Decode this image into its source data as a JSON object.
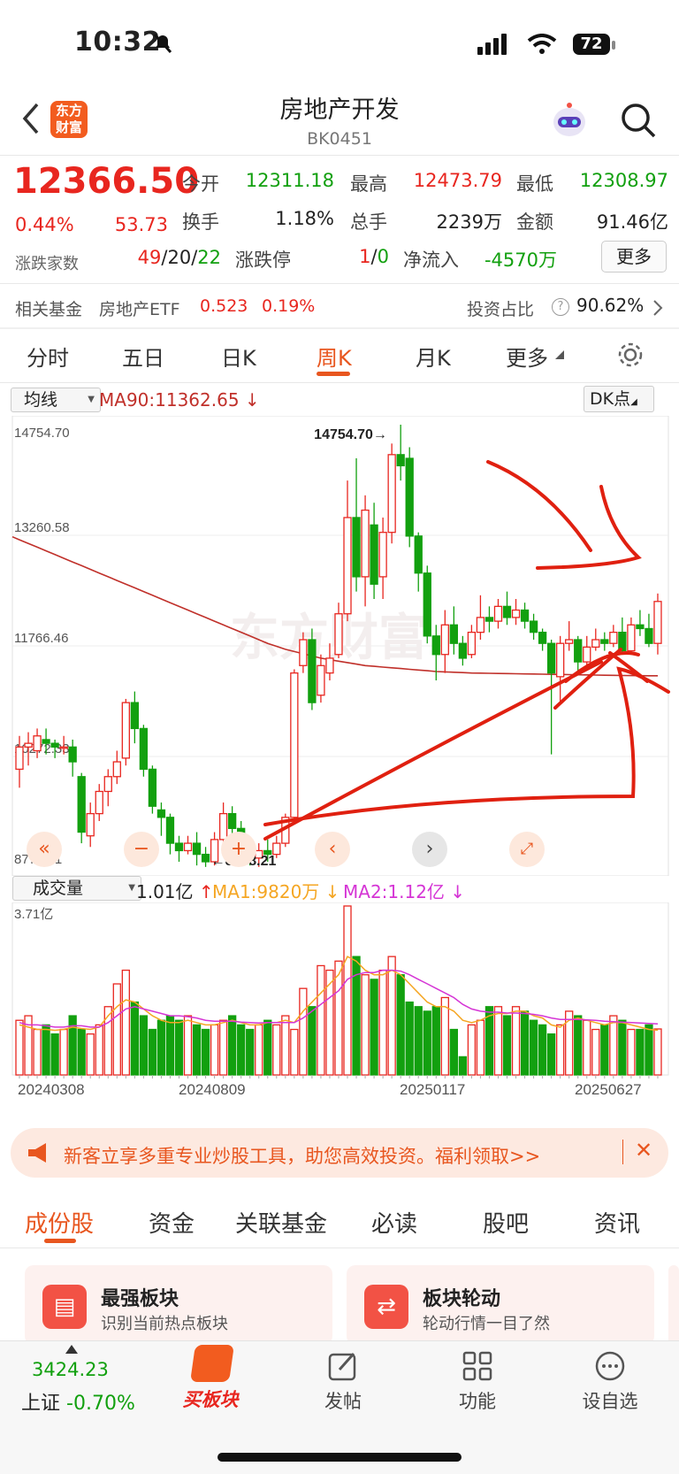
{
  "status_bar": {
    "time": "10:32",
    "battery": "72"
  },
  "header": {
    "logo_text": "东方财富",
    "title": "房地产开发",
    "code": "BK0451"
  },
  "quote": {
    "price": "12366.50",
    "change_pct": "0.44%",
    "change_abs": "53.73",
    "open_label": "今开",
    "open": "12311.18",
    "high_label": "最高",
    "high": "12473.79",
    "low_label": "最低",
    "low": "12308.97",
    "turnover_rate_label": "换手",
    "turnover_rate": "1.18%",
    "volume_label": "总手",
    "volume": "2239万",
    "amount_label": "金额",
    "amount": "91.46亿",
    "updown_label": "涨跌家数",
    "up_count": "49",
    "flat_count": "20",
    "down_count": "22",
    "limit_label": "涨跌停",
    "limit_up": "1",
    "limit_down": "0",
    "net_inflow_label": "净流入",
    "net_inflow": "-4570万",
    "more_label": "更多"
  },
  "fund_row": {
    "label": "相关基金",
    "fund_name": "房地产ETF",
    "fund_price": "0.523",
    "fund_change": "0.19%",
    "ratio_label": "投资占比",
    "ratio_value": "90.62%"
  },
  "period_tabs": [
    "分时",
    "五日",
    "日K",
    "周K",
    "月K",
    "更多"
  ],
  "active_period": "周K",
  "kline": {
    "indicator_select": "均线",
    "ma_label": "MA90:11362.65",
    "dk_label": "DK点",
    "axis_labels": [
      "14754.70",
      "13260.58",
      "11766.46",
      "10272.33",
      "8778.21"
    ],
    "max_label": "14754.70",
    "min_label": "8778.21",
    "watermark": "东方财富"
  },
  "volume_panel": {
    "select": "成交量",
    "current": "1.01亿",
    "ma1": "MA1:9820万",
    "ma2": "MA2:1.12亿",
    "max_label": "3.71亿",
    "dates": [
      "20240308",
      "20240809",
      "20250117",
      "20250627"
    ]
  },
  "colors": {
    "up": "#e8261f",
    "down": "#12a00f",
    "accent": "#e8561f",
    "ma90": "#c0302a",
    "ma1": "#f5a623",
    "ma2": "#d535d5"
  },
  "chart_data": {
    "type": "candlestick",
    "title": "",
    "ylim": [
      8778.21,
      14754.7
    ],
    "ma90": 11362.65,
    "candles": [
      {
        "o": 10100,
        "c": 10400,
        "h": 10550,
        "l": 9850
      },
      {
        "o": 10400,
        "c": 10450,
        "h": 10600,
        "l": 10150
      },
      {
        "o": 10350,
        "c": 10550,
        "h": 10650,
        "l": 10250
      },
      {
        "o": 10500,
        "c": 10450,
        "h": 10650,
        "l": 10300
      },
      {
        "o": 10450,
        "c": 10400,
        "h": 10500,
        "l": 10250
      },
      {
        "o": 10400,
        "c": 10400,
        "h": 10550,
        "l": 10300
      },
      {
        "o": 10400,
        "c": 10200,
        "h": 10500,
        "l": 10000
      },
      {
        "o": 10000,
        "c": 9250,
        "h": 10050,
        "l": 9100
      },
      {
        "o": 9200,
        "c": 9500,
        "h": 9650,
        "l": 9050
      },
      {
        "o": 9500,
        "c": 9800,
        "h": 9900,
        "l": 9400
      },
      {
        "o": 9800,
        "c": 10000,
        "h": 10100,
        "l": 9600
      },
      {
        "o": 10000,
        "c": 10200,
        "h": 10350,
        "l": 9900
      },
      {
        "o": 10250,
        "c": 11000,
        "h": 11050,
        "l": 10150
      },
      {
        "o": 11000,
        "c": 10650,
        "h": 11150,
        "l": 10450
      },
      {
        "o": 10650,
        "c": 10100,
        "h": 10700,
        "l": 10000
      },
      {
        "o": 10100,
        "c": 9600,
        "h": 10150,
        "l": 9500
      },
      {
        "o": 9550,
        "c": 9450,
        "h": 9650,
        "l": 9200
      },
      {
        "o": 9450,
        "c": 9100,
        "h": 9500,
        "l": 8950
      },
      {
        "o": 9100,
        "c": 9000,
        "h": 9200,
        "l": 8850
      },
      {
        "o": 9000,
        "c": 9100,
        "h": 9200,
        "l": 8950
      },
      {
        "o": 9100,
        "c": 8950,
        "h": 9250,
        "l": 8800
      },
      {
        "o": 8950,
        "c": 8850,
        "h": 9050,
        "l": 8780
      },
      {
        "o": 8850,
        "c": 9150,
        "h": 9250,
        "l": 8800
      },
      {
        "o": 9150,
        "c": 9500,
        "h": 9650,
        "l": 9100
      },
      {
        "o": 9500,
        "c": 9300,
        "h": 9600,
        "l": 9150
      },
      {
        "o": 9300,
        "c": 9100,
        "h": 9400,
        "l": 9000
      },
      {
        "o": 9100,
        "c": 8900,
        "h": 9150,
        "l": 8800
      },
      {
        "o": 8900,
        "c": 9000,
        "h": 9100,
        "l": 8780
      },
      {
        "o": 9000,
        "c": 8950,
        "h": 9150,
        "l": 8850
      },
      {
        "o": 8950,
        "c": 9100,
        "h": 9200,
        "l": 8900
      },
      {
        "o": 9100,
        "c": 9450,
        "h": 9500,
        "l": 9050
      },
      {
        "o": 9450,
        "c": 11400,
        "h": 11450,
        "l": 9400
      },
      {
        "o": 11500,
        "c": 11850,
        "h": 11950,
        "l": 11400
      },
      {
        "o": 11850,
        "c": 11000,
        "h": 12000,
        "l": 10900
      },
      {
        "o": 11100,
        "c": 11500,
        "h": 11650,
        "l": 11000
      },
      {
        "o": 11400,
        "c": 11600,
        "h": 11800,
        "l": 11300
      },
      {
        "o": 11650,
        "c": 12200,
        "h": 12350,
        "l": 11600
      },
      {
        "o": 12200,
        "c": 13500,
        "h": 14000,
        "l": 12100
      },
      {
        "o": 13500,
        "c": 12700,
        "h": 14300,
        "l": 12500
      },
      {
        "o": 12700,
        "c": 13600,
        "h": 13800,
        "l": 12300
      },
      {
        "o": 13400,
        "c": 12600,
        "h": 13700,
        "l": 12400
      },
      {
        "o": 12700,
        "c": 13300,
        "h": 13500,
        "l": 12400
      },
      {
        "o": 13300,
        "c": 14350,
        "h": 14500,
        "l": 13150
      },
      {
        "o": 14350,
        "c": 14200,
        "h": 14754.7,
        "l": 14000
      },
      {
        "o": 14300,
        "c": 13250,
        "h": 14450,
        "l": 13100
      },
      {
        "o": 13250,
        "c": 12750,
        "h": 13300,
        "l": 12500
      },
      {
        "o": 12750,
        "c": 11900,
        "h": 12850,
        "l": 11800
      },
      {
        "o": 11900,
        "c": 11650,
        "h": 12050,
        "l": 11300
      },
      {
        "o": 11650,
        "c": 12050,
        "h": 12250,
        "l": 11400
      },
      {
        "o": 12050,
        "c": 11800,
        "h": 12300,
        "l": 11650
      },
      {
        "o": 11800,
        "c": 11600,
        "h": 11900,
        "l": 11500
      },
      {
        "o": 11650,
        "c": 11950,
        "h": 12050,
        "l": 11600
      },
      {
        "o": 11950,
        "c": 12150,
        "h": 12450,
        "l": 11850
      },
      {
        "o": 12150,
        "c": 12100,
        "h": 12300,
        "l": 11950
      },
      {
        "o": 12100,
        "c": 12300,
        "h": 12400,
        "l": 12000
      },
      {
        "o": 12300,
        "c": 12150,
        "h": 12500,
        "l": 12050
      },
      {
        "o": 12150,
        "c": 12250,
        "h": 12400,
        "l": 12050
      },
      {
        "o": 12250,
        "c": 12100,
        "h": 12350,
        "l": 12000
      },
      {
        "o": 12100,
        "c": 11950,
        "h": 12200,
        "l": 11850
      },
      {
        "o": 11950,
        "c": 11800,
        "h": 12000,
        "l": 11700
      },
      {
        "o": 11800,
        "c": 11400,
        "h": 11850,
        "l": 10300
      },
      {
        "o": 11350,
        "c": 11800,
        "h": 11900,
        "l": 11000
      },
      {
        "o": 11800,
        "c": 11850,
        "h": 12100,
        "l": 11700
      },
      {
        "o": 11850,
        "c": 11550,
        "h": 11900,
        "l": 11400
      },
      {
        "o": 11550,
        "c": 11750,
        "h": 11900,
        "l": 11500
      },
      {
        "o": 11750,
        "c": 11850,
        "h": 12000,
        "l": 11700
      },
      {
        "o": 11850,
        "c": 11800,
        "h": 11950,
        "l": 11700
      },
      {
        "o": 11800,
        "c": 11950,
        "h": 12050,
        "l": 11750
      },
      {
        "o": 11950,
        "c": 11700,
        "h": 12150,
        "l": 11650
      },
      {
        "o": 11700,
        "c": 12050,
        "h": 12150,
        "l": 11650
      },
      {
        "o": 12050,
        "c": 12000,
        "h": 12250,
        "l": 11900
      },
      {
        "o": 12000,
        "c": 11800,
        "h": 12200,
        "l": 11750
      },
      {
        "o": 11800,
        "c": 12366.5,
        "h": 12473.79,
        "l": 11650
      }
    ],
    "ma90_line": [
      13200,
      13150,
      13100,
      13050,
      13000,
      12950,
      12900,
      12850,
      12800,
      12750,
      12700,
      12650,
      12600,
      12550,
      12500,
      12450,
      12400,
      12350,
      12300,
      12250,
      12200,
      12150,
      12100,
      12050,
      12000,
      11950,
      11900,
      11850,
      11800,
      11760,
      11720,
      11690,
      11660,
      11630,
      11600,
      11580,
      11560,
      11540,
      11520,
      11500,
      11490,
      11480,
      11470,
      11460,
      11450,
      11440,
      11430,
      11420,
      11415,
      11410,
      11405,
      11400,
      11398,
      11396,
      11394,
      11392,
      11390,
      11388,
      11386,
      11384,
      11382,
      11380,
      11378,
      11376,
      11374,
      11372,
      11370,
      11368,
      11366,
      11365,
      11364,
      11363,
      11362.65
    ],
    "volumes": [
      1.2,
      1.3,
      1.0,
      1.1,
      0.9,
      1.0,
      1.3,
      1.0,
      0.9,
      1.1,
      1.5,
      2.0,
      2.3,
      1.6,
      1.3,
      1.0,
      1.2,
      1.3,
      1.2,
      1.3,
      1.1,
      1.0,
      1.1,
      1.2,
      1.3,
      1.1,
      1.0,
      1.1,
      1.2,
      1.1,
      1.3,
      1.0,
      1.9,
      1.5,
      2.4,
      2.3,
      2.5,
      3.71,
      2.6,
      2.2,
      2.1,
      2.3,
      2.6,
      2.2,
      1.6,
      1.5,
      1.4,
      1.5,
      1.7,
      1.0,
      0.4,
      1.1,
      1.2,
      1.5,
      1.5,
      1.3,
      1.5,
      1.4,
      1.2,
      1.1,
      0.9,
      1.1,
      1.4,
      1.3,
      1.2,
      1.0,
      1.1,
      1.3,
      1.2,
      1.0,
      1.0,
      1.1,
      1.01
    ],
    "ma1_line": [
      1.1,
      1.05,
      1.0,
      1.0,
      0.98,
      1.0,
      1.05,
      1.02,
      1.0,
      1.05,
      1.3,
      1.5,
      1.65,
      1.6,
      1.45,
      1.3,
      1.2,
      1.15,
      1.15,
      1.2,
      1.15,
      1.1,
      1.1,
      1.15,
      1.2,
      1.15,
      1.1,
      1.1,
      1.15,
      1.15,
      1.2,
      1.15,
      1.4,
      1.6,
      1.8,
      2.0,
      2.2,
      2.6,
      2.5,
      2.3,
      2.2,
      2.2,
      2.3,
      2.2,
      2.0,
      1.8,
      1.6,
      1.5,
      1.5,
      1.4,
      1.2,
      1.15,
      1.2,
      1.3,
      1.35,
      1.35,
      1.4,
      1.4,
      1.3,
      1.25,
      1.1,
      1.05,
      1.2,
      1.25,
      1.2,
      1.15,
      1.1,
      1.15,
      1.15,
      1.1,
      1.05,
      1.0,
      0.982
    ],
    "ma2_line": [
      1.15,
      1.1,
      1.1,
      1.08,
      1.05,
      1.05,
      1.08,
      1.08,
      1.05,
      1.05,
      1.15,
      1.3,
      1.45,
      1.5,
      1.45,
      1.4,
      1.35,
      1.3,
      1.3,
      1.28,
      1.25,
      1.2,
      1.18,
      1.18,
      1.18,
      1.16,
      1.15,
      1.14,
      1.15,
      1.15,
      1.15,
      1.15,
      1.25,
      1.4,
      1.55,
      1.7,
      1.85,
      2.1,
      2.2,
      2.25,
      2.25,
      2.3,
      2.3,
      2.28,
      2.2,
      2.1,
      2.0,
      1.9,
      1.8,
      1.7,
      1.55,
      1.45,
      1.4,
      1.38,
      1.38,
      1.36,
      1.36,
      1.35,
      1.33,
      1.3,
      1.25,
      1.22,
      1.22,
      1.22,
      1.21,
      1.2,
      1.18,
      1.17,
      1.16,
      1.15,
      1.14,
      1.13,
      1.12
    ]
  },
  "banner": {
    "text": "新客立享多重专业炒股工具，助您高效投资。福利领取>>"
  },
  "sub_tabs": [
    "成份股",
    "资金",
    "关联基金",
    "必读",
    "股吧",
    "资讯"
  ],
  "cards": [
    {
      "title": "最强板块",
      "subtitle": "识别当前热点板块"
    },
    {
      "title": "板块轮动",
      "subtitle": "轮动行情一目了然"
    }
  ],
  "bottom_bar": {
    "index_value": "3424.23",
    "index_name": "上证",
    "index_change": "-0.70%",
    "nav": [
      "买板块",
      "发帖",
      "功能",
      "设自选"
    ]
  }
}
